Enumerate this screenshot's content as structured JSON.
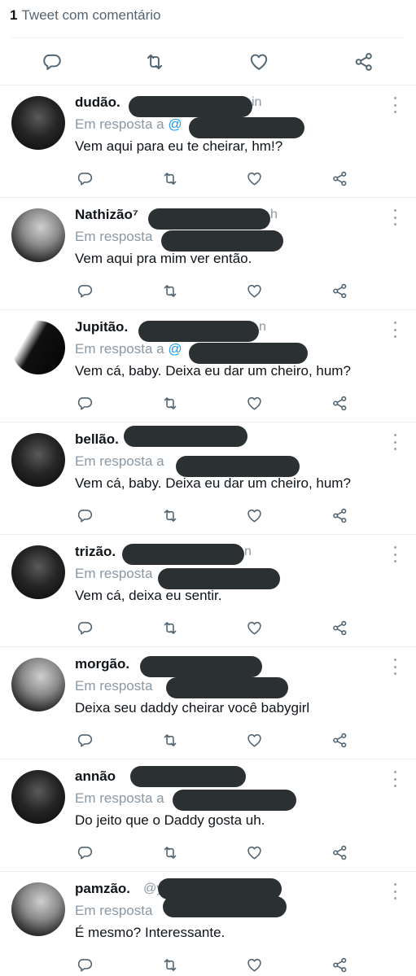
{
  "header": {
    "quote_count": "1",
    "quote_label": "Tweet com comentário",
    "actions": [
      "reply-icon",
      "retweet-icon",
      "like-icon",
      "share-icon"
    ]
  },
  "colors": {
    "text": "#0f1419",
    "secondary": "#8a98a5",
    "link": "#1d9bf0",
    "redaction": "#2b3033",
    "divider": "#e6ecf0"
  },
  "tweets": [
    {
      "name": "dudão.",
      "tail": "in",
      "reply": "Em resposta a",
      "mention": "@",
      "text": "Vem aqui para eu te cheirar, hm!?"
    },
    {
      "name": "Nathizão⁷",
      "tail": "h",
      "reply": "Em resposta",
      "mention": "",
      "text": "Vem aqui pra mim ver então."
    },
    {
      "name": "Jupitão.",
      "tail": "n",
      "reply": "Em resposta a",
      "mention": "@",
      "text": "Vem cá, baby. Deixa eu dar um cheiro, hum?"
    },
    {
      "name": "bellão.",
      "tail": "",
      "reply": "Em resposta a",
      "mention": "",
      "text": "Vem cá, baby. Deixa eu dar um cheiro, hum?"
    },
    {
      "name": "trizão.",
      "tail": "n",
      "reply": "Em resposta",
      "mention": "",
      "text": "Vem cá, deixa eu sentir."
    },
    {
      "name": "morgão.",
      "tail": "",
      "reply": "Em resposta",
      "mention": "",
      "text": "Deixa seu daddy cheirar você babygirl"
    },
    {
      "name": "annão",
      "tail": "",
      "reply": "Em resposta a",
      "mention": "",
      "text": "Do jeito que o Daddy gosta uh."
    },
    {
      "name": "pamzão.",
      "tail": "@y",
      "reply": "Em resposta",
      "mention": "",
      "text": "É mesmo? Interessante."
    }
  ]
}
